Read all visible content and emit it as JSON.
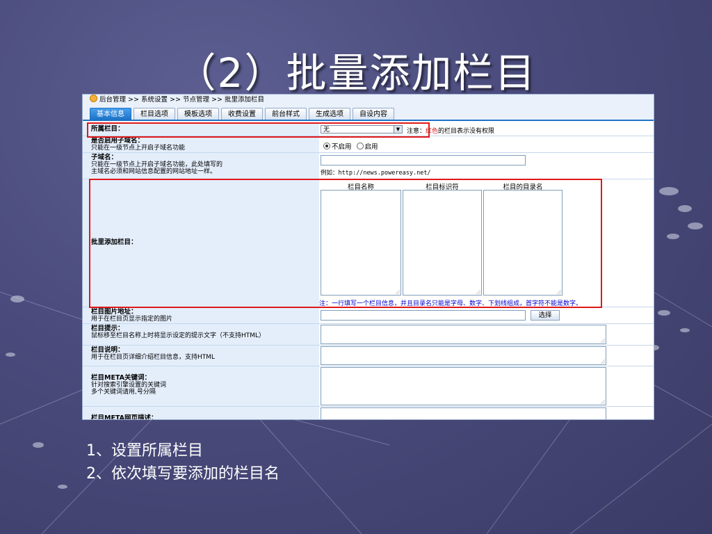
{
  "slide": {
    "title": "（2）批量添加栏目",
    "notes": [
      "1、设置所属栏目",
      "2、依次填写要添加的栏目名"
    ]
  },
  "breadcrumb": {
    "items": [
      "后台管理",
      ">>",
      "系统设置",
      ">>",
      "节点管理",
      ">>",
      "批里添加栏目"
    ]
  },
  "tabs": [
    "基本信息",
    "栏目选项",
    "模板选项",
    "收费设置",
    "前台样式",
    "生成选项",
    "自设内容"
  ],
  "form": {
    "parent": {
      "label": "所属栏目：",
      "value": "无",
      "note_prefix": "注意：",
      "note_red": "红色",
      "note_suffix": "的栏目表示没有权限"
    },
    "subdomain_enable": {
      "label": "是否启用子域名：",
      "desc": "只能在一级节点上开启子域名功能",
      "option_off": "不启用",
      "option_on": "启用",
      "selected": "不启用"
    },
    "subdomain": {
      "label": "子域名：",
      "desc1": "只能在一级节点上开启子域名功能，此处填写的",
      "desc2": "主域名必须和网站信息配置的网站地址一样。",
      "example": "例如：http://news.powereasy.net/"
    },
    "batch": {
      "label": "批里添加栏目：",
      "col1": "栏目名称",
      "col2": "栏目标识符",
      "col3": "栏目的目录名",
      "hint": "注：一行填写一个栏目信息，并且目录名只能是字母、数字、下划线组成，首字符不能是数字。"
    },
    "image": {
      "label": "栏目图片地址：",
      "desc": "用于在栏目页显示指定的图片",
      "button": "选择"
    },
    "tip": {
      "label": "栏目提示：",
      "desc": "鼠标移至栏目名称上时将显示设定的提示文字（不支持HTML）"
    },
    "description": {
      "label": "栏目说明：",
      "desc": "用于在栏目页详细介绍栏目信息，支持HTML"
    },
    "meta_keywords": {
      "label": "栏目META关键词：",
      "desc1": "针对搜索引擎设置的关键词",
      "desc2": "多个关键词请用,号分隔"
    },
    "meta_desc": {
      "label": "栏目META网页描述："
    }
  },
  "colors": {
    "accent": "#1c73c8",
    "highlight": "#e01818",
    "label_bg": "#e4eefb"
  }
}
